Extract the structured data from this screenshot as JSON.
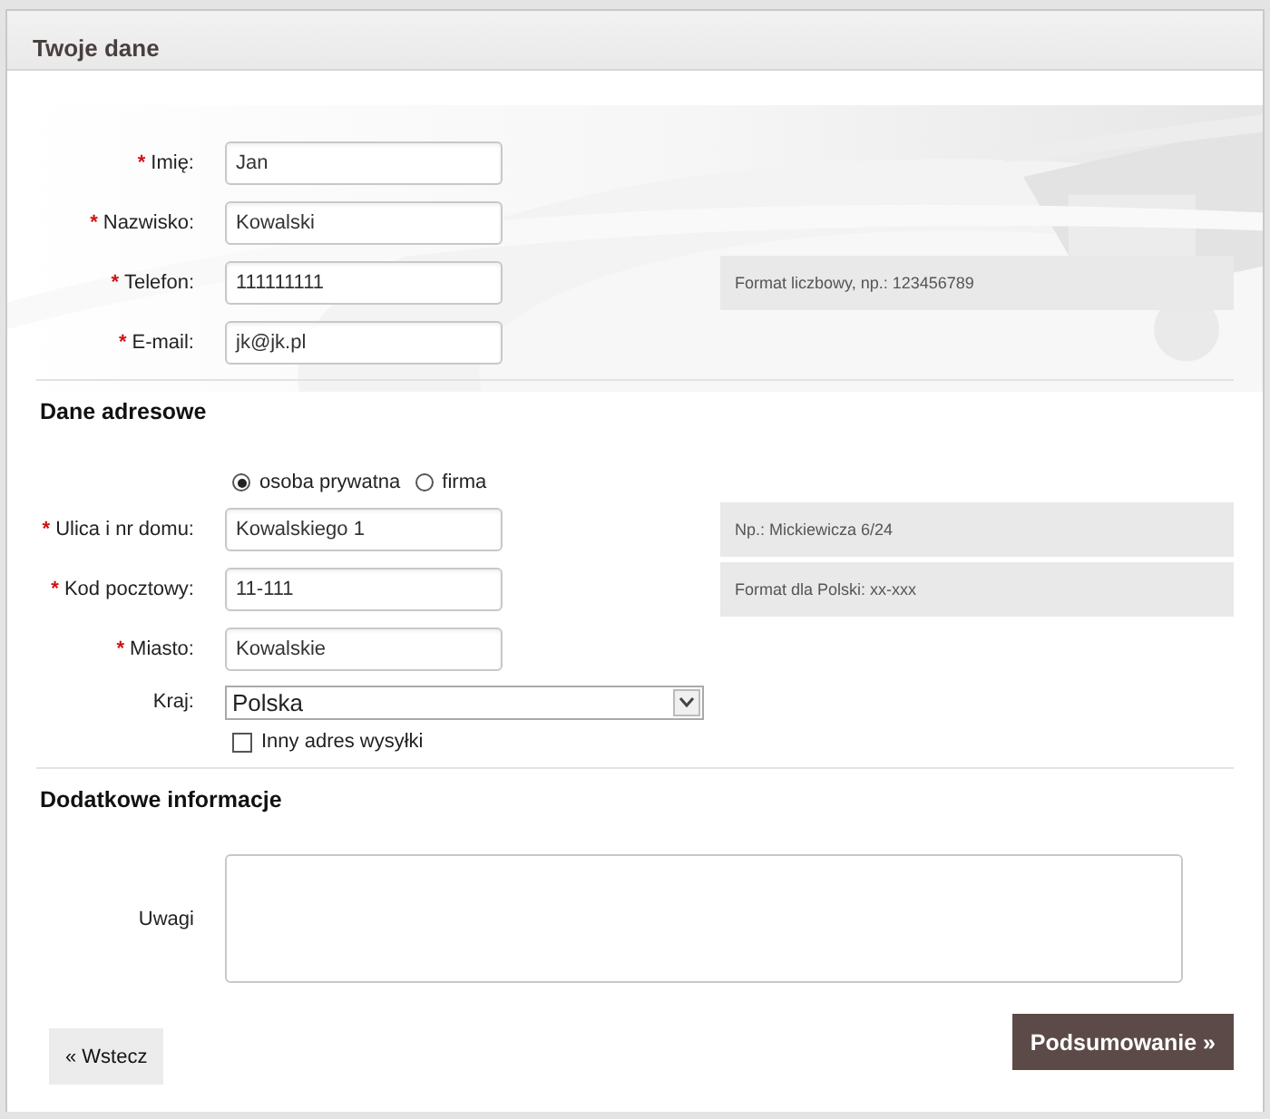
{
  "section_title": "Twoje dane",
  "personal_fields": [
    {
      "mark": "*",
      "label": "Imię:",
      "value": "Jan"
    },
    {
      "mark": "*",
      "label": "Nazwisko:",
      "value": "Kowalski"
    },
    {
      "mark": "*",
      "label": "Telefon:",
      "value": "111111111",
      "hint": "Format liczbowy, np.: 123456789"
    },
    {
      "mark": "*",
      "label": "E-mail:",
      "value": "jk@jk.pl"
    }
  ],
  "address": {
    "title": "Dane adresowe",
    "customer_type": [
      {
        "label": "osoba prywatna",
        "selected": true
      },
      {
        "label": "firma",
        "selected": false
      }
    ],
    "fields": [
      {
        "mark": "*",
        "label": "Ulica i nr domu:",
        "value": "Kowalskiego 1",
        "hint": "Np.: Mickiewicza 6/24"
      },
      {
        "mark": "*",
        "label": "Kod pocztowy:",
        "value": "11-111",
        "hint": "Format dla Polski: xx-xxx"
      },
      {
        "mark": "*",
        "label": "Miasto:",
        "value": "Kowalskie"
      }
    ],
    "country": {
      "label": "Kraj:",
      "value": "Polska"
    },
    "other_shipping": {
      "label": "Inny adres wysyłki",
      "checked": false
    }
  },
  "additional": {
    "title": "Dodatkowe informacje",
    "notes_label": "Uwagi"
  },
  "buttons": {
    "back": "« Wstecz",
    "next": "Podsumowanie »"
  }
}
